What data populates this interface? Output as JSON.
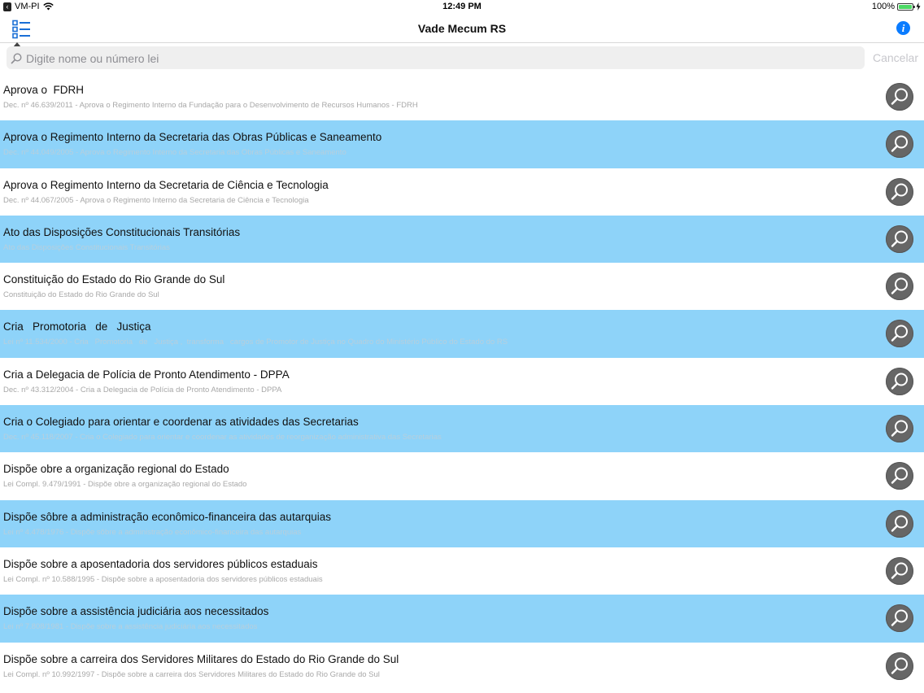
{
  "status_bar": {
    "carrier": "VM-PI",
    "back_glyph": "‹",
    "time": "12:49 PM",
    "battery": "100%",
    "battery_level": 1.0
  },
  "nav": {
    "title": "Vade Mecum RS",
    "menu_icon": "list-icon",
    "info_icon": "info-icon",
    "info_glyph": "i"
  },
  "search": {
    "placeholder": "Digite nome ou número lei",
    "value": "",
    "cancel_label": "Cancelar"
  },
  "colors": {
    "row_highlight": "#8ed3f9",
    "accent": "#0a7cff",
    "row_button": "#666666"
  },
  "items": [
    {
      "title": "Aprova o  FDRH",
      "subtitle": "Dec. nº 46.639/2011 - Aprova o Regimento Interno da Fundação para o Desenvolvimento de Recursos Humanos - FDRH",
      "highlighted": false
    },
    {
      "title": "Aprova o Regimento Interno da Secretaria das Obras Públicas e Saneamento",
      "subtitle": "Dec. nº 44.049/2005 - Aprova o Regimento Interno da Secretaria das Obras Públicas e Saneamento",
      "highlighted": true
    },
    {
      "title": "Aprova o Regimento Interno da Secretaria de Ciência e Tecnologia",
      "subtitle": "Dec. nº 44.067/2005 - Aprova o Regimento Interno da Secretaria de Ciência e Tecnologia",
      "highlighted": false
    },
    {
      "title": "Ato das Disposições Constitucionais Transitórias",
      "subtitle": "Ato das Disposições Constitucionais Transitórias",
      "highlighted": true
    },
    {
      "title": "Constituição do Estado do Rio Grande do Sul",
      "subtitle": "Constituição do Estado do Rio Grande do Sul",
      "highlighted": false
    },
    {
      "title": "Cria   Promotoria   de   Justiça",
      "subtitle": "Lei nº 11.534/2000 - Cria   Promotoria   de   Justiça ,  transforma   cargos de Promotor de Justiça no Quadro do Ministério Público do Estado do RS",
      "highlighted": true
    },
    {
      "title": "Cria a Delegacia de Polícia de Pronto Atendimento - DPPA",
      "subtitle": "Dec. nº 43.312/2004 - Cria a Delegacia de Polícia de Pronto Atendimento - DPPA",
      "highlighted": false
    },
    {
      "title": "Cria o Colegiado para orientar e coordenar as atividades das Secretarias",
      "subtitle": "Dec. nº 45.118/2007 - Cria o Colegiado para orientar e coordenar as atividades de reorganização administrativa das Secretarias",
      "highlighted": true
    },
    {
      "title": "Dispõe obre a organização regional do Estado",
      "subtitle": "Lei Compl. 9.479/1991 - Dispõe obre a organização regional do Estado",
      "highlighted": false
    },
    {
      "title": "Dispõe sôbre a administração econômico-financeira das autarquias",
      "subtitle": "Lei nº 4.478/1976 - Dispõe sôbre a administração econômico-financeira das autarquias",
      "highlighted": true
    },
    {
      "title": "Dispõe sobre a aposentadoria dos servidores públicos estaduais",
      "subtitle": "Lei Compl. nº 10.588/1995 - Dispõe sobre a aposentadoria dos servidores públicos estaduais",
      "highlighted": false
    },
    {
      "title": "Dispõe sobre a assistência judiciária aos necessitados",
      "subtitle": "Lei nº 7.808/1981 - Dispõe sobre a assistência judiciária aos necessitados",
      "highlighted": true
    },
    {
      "title": "Dispõe sobre a carreira dos Servidores Militares do Estado do Rio Grande do Sul",
      "subtitle": "Lei Compl. nº 10.992/1997 - Dispõe sobre a carreira dos Servidores Militares do Estado do Rio Grande do Sul",
      "highlighted": false
    }
  ]
}
